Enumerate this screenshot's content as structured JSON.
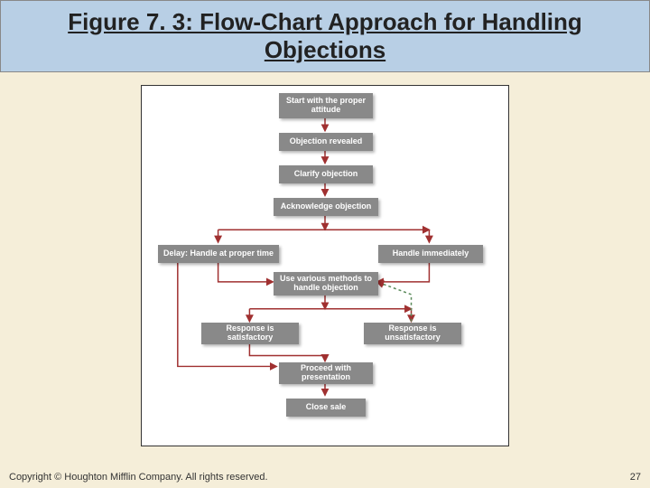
{
  "title": "Figure 7. 3:  Flow-Chart Approach for Handling Objections",
  "nodes": {
    "start": "Start with the proper attitude",
    "revealed": "Objection revealed",
    "clarify": "Clarify objection",
    "acknowledge": "Acknowledge objection",
    "delay": "Delay: Handle at proper time",
    "immediate": "Handle immediately",
    "methods": "Use various methods to handle objection",
    "satisfactory": "Response is satisfactory",
    "unsatisfactory": "Response is unsatisfactory",
    "proceed": "Proceed with presentation",
    "close": "Close sale"
  },
  "footer": {
    "copyright": "Copyright © Houghton Mifflin Company. All rights reserved.",
    "page": "27"
  }
}
